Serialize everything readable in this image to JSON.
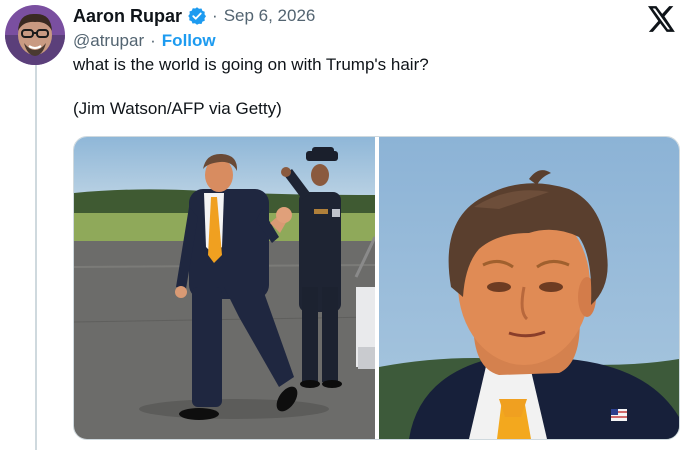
{
  "tweet": {
    "author": {
      "display_name": "Aaron Rupar",
      "handle": "@atrupar",
      "verified_icon": "verified-badge-icon"
    },
    "separator": "·",
    "date": "Sep 6, 2026",
    "follow_label": "Follow",
    "text_lines": [
      "what is the world is going on with Trump's hair?",
      "(Jim Watson/AFP via Getty)"
    ],
    "platform_icon": "x-logo-icon"
  },
  "colors": {
    "text_primary": "#0f1419",
    "text_secondary": "#536471",
    "accent": "#1d9bf0",
    "tie": "#f0a020"
  }
}
